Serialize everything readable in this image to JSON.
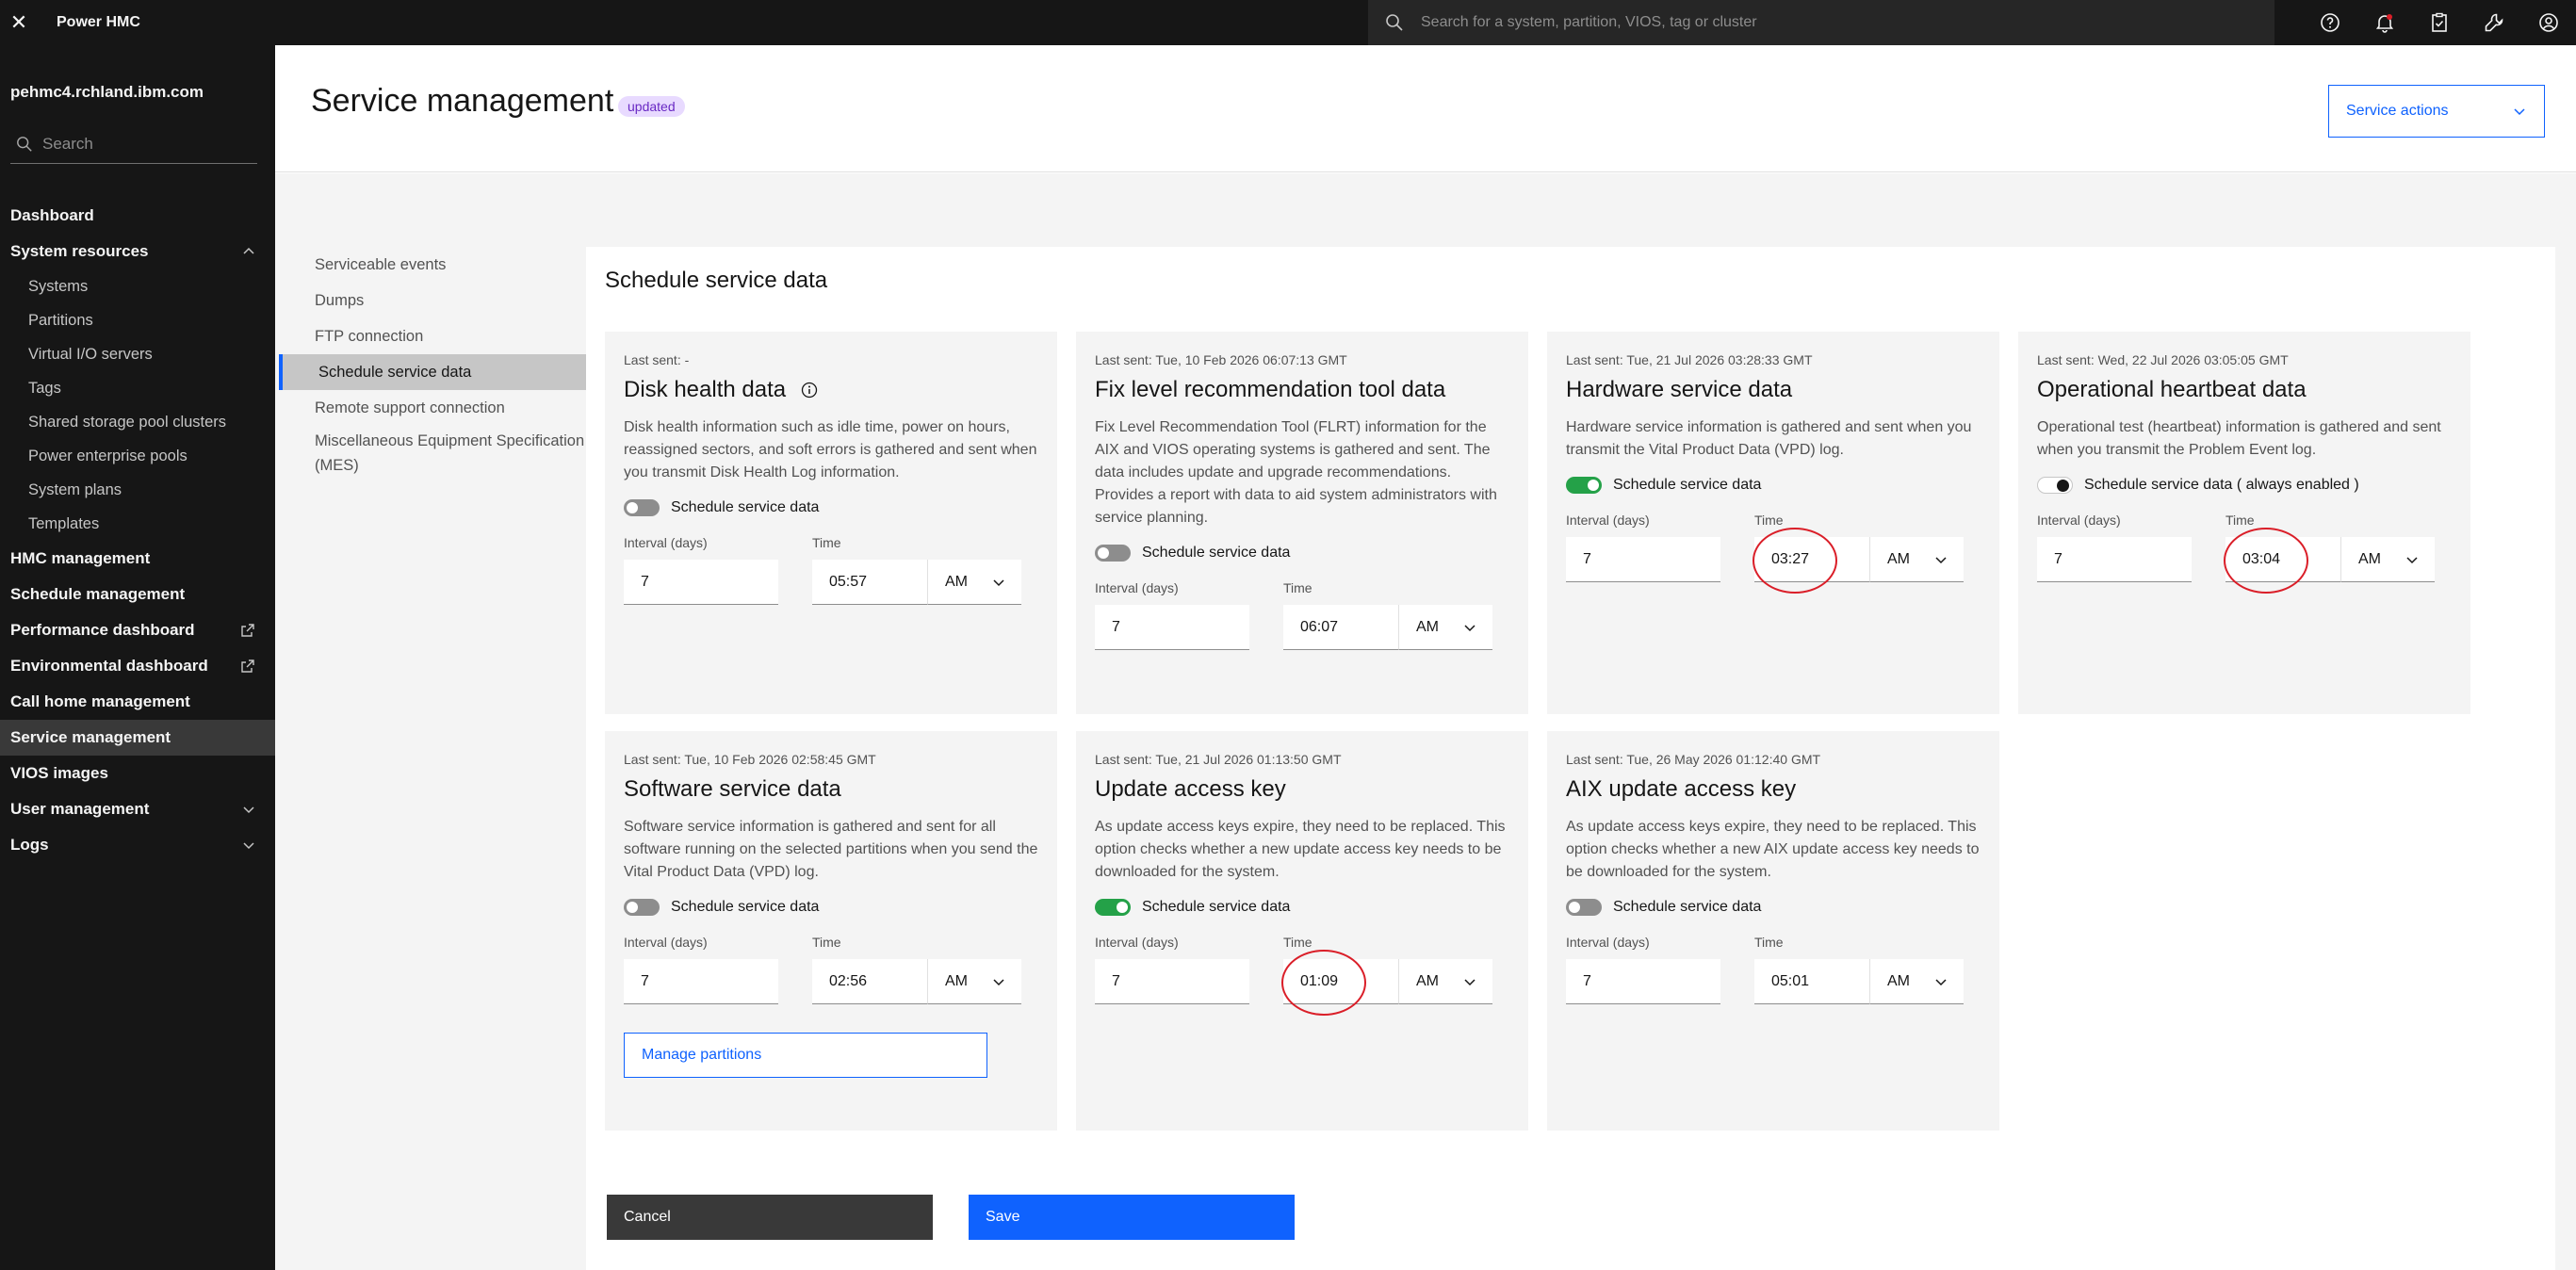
{
  "header": {
    "close_label": "✕",
    "brand": "Power HMC",
    "search_placeholder": "Search for a system, partition, VIOS, tag or cluster"
  },
  "leftnav": {
    "host": "pehmc4.rchland.ibm.com",
    "search_placeholder": "Search",
    "items": [
      {
        "label": "Dashboard"
      },
      {
        "label": "System resources"
      },
      {
        "label": "Systems"
      },
      {
        "label": "Partitions"
      },
      {
        "label": "Virtual I/O servers"
      },
      {
        "label": "Tags"
      },
      {
        "label": "Shared storage pool clusters"
      },
      {
        "label": "Power enterprise pools"
      },
      {
        "label": "System plans"
      },
      {
        "label": "Templates"
      },
      {
        "label": "HMC management"
      },
      {
        "label": "Schedule management"
      },
      {
        "label": "Performance dashboard"
      },
      {
        "label": "Environmental dashboard"
      },
      {
        "label": "Call home management"
      },
      {
        "label": "Service management"
      },
      {
        "label": "VIOS images"
      },
      {
        "label": "User management"
      },
      {
        "label": "Logs"
      }
    ]
  },
  "page": {
    "title": "Service management",
    "badge": "updated",
    "actions_label": "Service actions"
  },
  "subnav": {
    "items": [
      {
        "label": "Serviceable events"
      },
      {
        "label": "Dumps"
      },
      {
        "label": "FTP connection"
      },
      {
        "label": "Schedule service data"
      },
      {
        "label": "Remote support connection"
      },
      {
        "label": "Miscellaneous Equipment Specification (MES)"
      }
    ]
  },
  "main": {
    "title": "Schedule service data",
    "interval_label": "Interval (days)",
    "time_label": "Time",
    "toggle_label": "Schedule service data",
    "toggle_label_always": "Schedule service data ( always enabled )",
    "cards": [
      {
        "last_sent": "Last sent: -",
        "title": "Disk health data",
        "desc": "Disk health information such as idle time, power on hours, reassigned sectors, and soft errors is gathered and sent when you transmit Disk Health Log information.",
        "enabled": false,
        "interval": "7",
        "time": "05:57",
        "ampm": "AM"
      },
      {
        "last_sent": "Last sent: Tue, 10 Feb 2026 06:07:13 GMT",
        "title": "Fix level recommendation tool data",
        "desc": "Fix Level Recommendation Tool (FLRT) information for the AIX and VIOS operating systems is gathered and sent. The data includes update and upgrade recommendations. Provides a report with data to aid system administrators with service planning.",
        "enabled": false,
        "interval": "7",
        "time": "06:07",
        "ampm": "AM"
      },
      {
        "last_sent": "Last sent: Tue, 21 Jul 2026 03:28:33 GMT",
        "title": "Hardware service data",
        "desc": "Hardware service information is gathered and sent when you transmit the Vital Product Data (VPD) log.",
        "enabled": true,
        "interval": "7",
        "time": "03:27",
        "ampm": "AM"
      },
      {
        "last_sent": "Last sent: Wed, 22 Jul 2026 03:05:05 GMT",
        "title": "Operational heartbeat data",
        "desc": "Operational test (heartbeat) information is gathered and sent when you transmit the Problem Event log.",
        "enabled": true,
        "interval": "7",
        "time": "03:04",
        "ampm": "AM"
      },
      {
        "last_sent": "Last sent: Tue, 10 Feb 2026 02:58:45 GMT",
        "title": "Software service data",
        "desc": "Software service information is gathered and sent for all software running on the selected partitions when you send the Vital Product Data (VPD) log.",
        "enabled": false,
        "interval": "7",
        "time": "02:56",
        "ampm": "AM",
        "manage_label": "Manage partitions"
      },
      {
        "last_sent": "Last sent: Tue, 21 Jul 2026 01:13:50 GMT",
        "title": "Update access key",
        "desc": "As update access keys expire, they need to be replaced. This option checks whether a new update access key needs to be downloaded for the system.",
        "enabled": true,
        "interval": "7",
        "time": "01:09",
        "ampm": "AM"
      },
      {
        "last_sent": "Last sent: Tue, 26 May 2026 01:12:40 GMT",
        "title": "AIX update access key",
        "desc": "As update access keys expire, they need to be replaced. This option checks whether a new AIX update access key needs to be downloaded for the system.",
        "enabled": false,
        "interval": "7",
        "time": "05:01",
        "ampm": "AM"
      }
    ]
  },
  "footer": {
    "cancel": "Cancel",
    "save": "Save"
  },
  "colors": {
    "accent": "#0f62fe",
    "toggle_on": "#24a148",
    "highlight_circle": "#da1e28"
  }
}
